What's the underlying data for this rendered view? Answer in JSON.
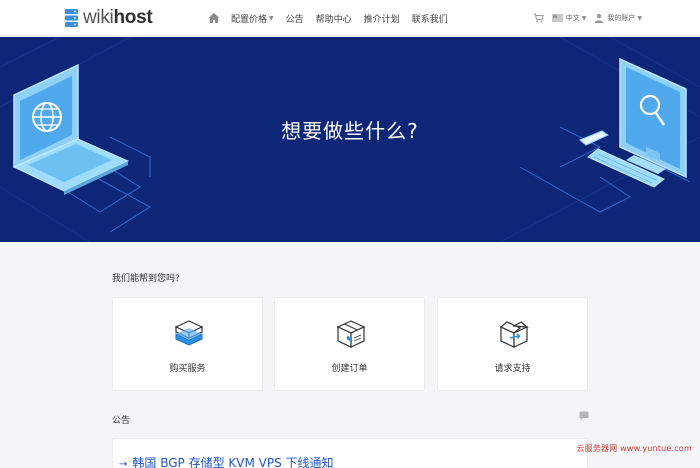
{
  "brand": {
    "logo_prefix": "wiki",
    "logo_suffix": "host"
  },
  "nav": {
    "items": [
      {
        "label": "配置价格",
        "has_caret": true
      },
      {
        "label": "公告"
      },
      {
        "label": "帮助中心"
      },
      {
        "label": "推介计划"
      },
      {
        "label": "联系我们"
      }
    ],
    "language": "中文",
    "account": "我的账户"
  },
  "hero": {
    "title": "想要做些什么?"
  },
  "help": {
    "label": "我们能帮到您吗?",
    "cards": [
      {
        "label": "购买服务",
        "icon": "server-stack-icon"
      },
      {
        "label": "创建订单",
        "icon": "box-icon"
      },
      {
        "label": "请求支持",
        "icon": "support-box-icon"
      }
    ]
  },
  "announcements": {
    "label": "公告",
    "items": [
      {
        "title": "韩国 BGP 存储型 KVM VPS 下线通知"
      }
    ]
  },
  "watermark": "云服务器网 www.yuntue.com",
  "colors": {
    "hero_bg": "#0d2677",
    "accent_blue": "#1f56c8",
    "link_blue": "#1f56c8",
    "watermark_red": "#d23a3a"
  }
}
